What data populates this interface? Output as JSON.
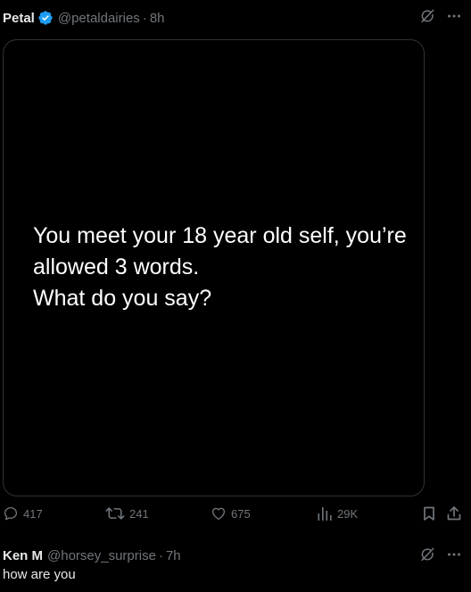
{
  "post": {
    "author_name": "Petal",
    "author_handle": "@petaldairies",
    "separator": "·",
    "time": "8h",
    "verified": true,
    "media_text": "You meet your 18 year old self, you’re\nallowed 3 words.\nWhat do you say?",
    "stats": {
      "replies": "417",
      "reposts": "241",
      "likes": "675",
      "views": "29K"
    }
  },
  "reply": {
    "author_name": "Ken M",
    "author_handle": "@horsey_surprise",
    "separator": "·",
    "time": "7h",
    "text": "how are you"
  },
  "colors": {
    "background": "#000000",
    "text": "#e7e9ea",
    "muted": "#71767b",
    "verified_blue": "#1d9bf0",
    "border": "#2f3336"
  },
  "icons": {
    "verified": "verified-badge-icon",
    "grok": "grok-icon",
    "more": "more-dots-icon",
    "reply": "reply-bubble-icon",
    "repost": "repost-arrows-icon",
    "like": "heart-icon",
    "views": "bar-chart-icon",
    "bookmark": "bookmark-icon",
    "share": "share-icon"
  }
}
